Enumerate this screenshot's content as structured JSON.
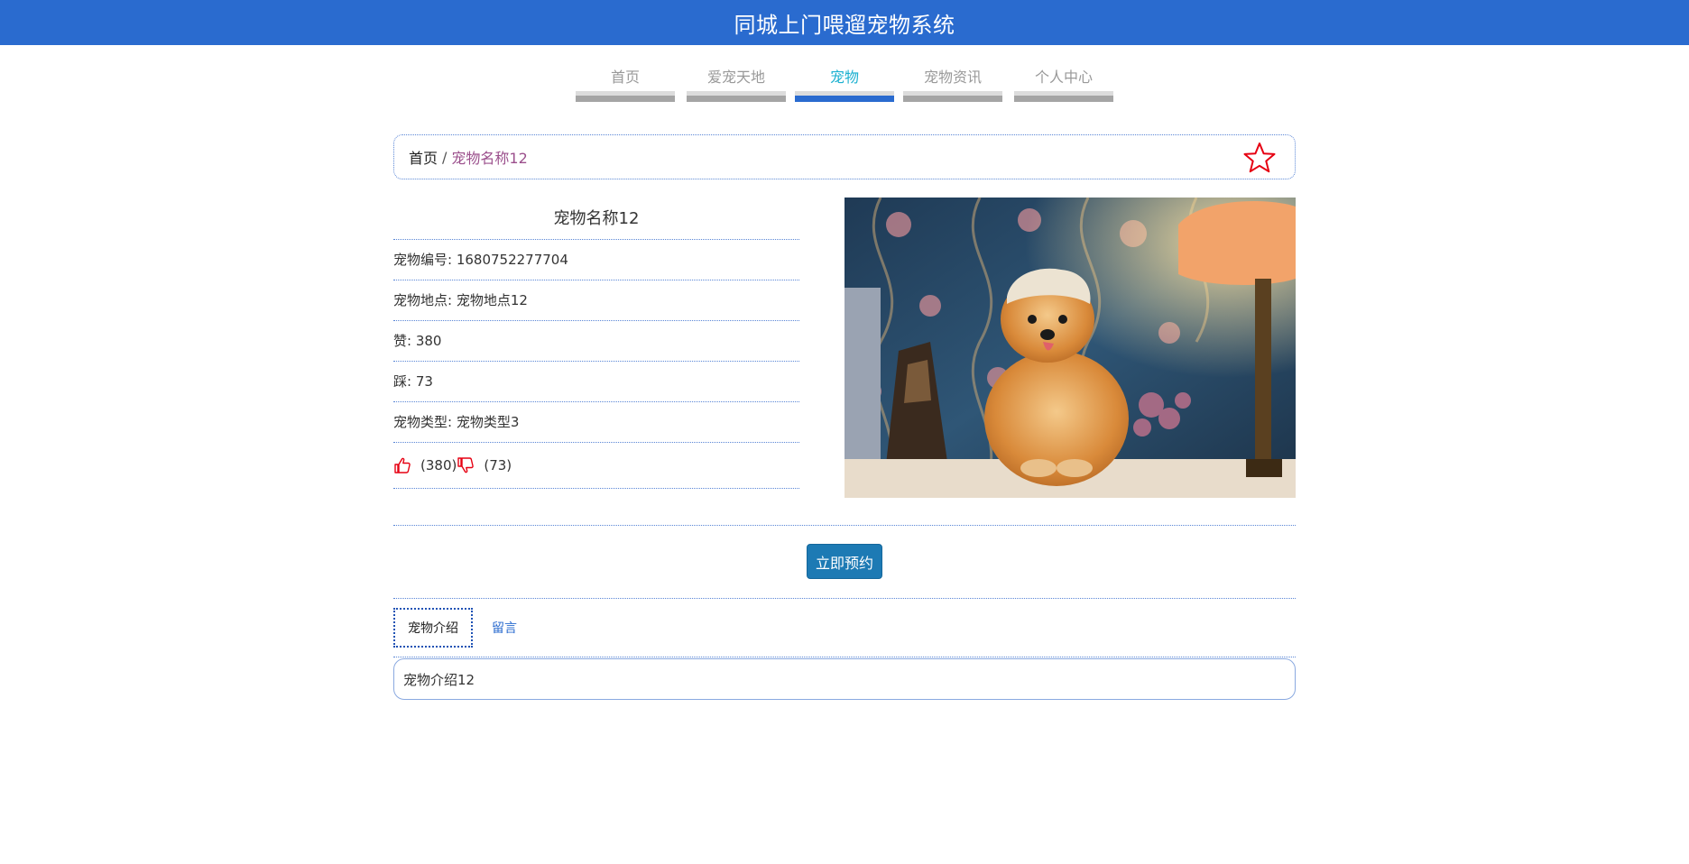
{
  "header": {
    "title": "同城上门喂遛宠物系统"
  },
  "nav": {
    "items": [
      {
        "label": "首页",
        "active": false
      },
      {
        "label": "爱宠天地",
        "active": false
      },
      {
        "label": "宠物",
        "active": true
      },
      {
        "label": "宠物资讯",
        "active": false
      },
      {
        "label": "个人中心",
        "active": false
      }
    ]
  },
  "breadcrumb": {
    "home": "首页",
    "separator": "/",
    "current": "宠物名称12"
  },
  "pet": {
    "name": "宠物名称12",
    "rows": [
      {
        "label": "宠物编号: 1680752277704"
      },
      {
        "label": "宠物地点: 宠物地点12"
      },
      {
        "label": "赞: 380"
      },
      {
        "label": "踩: 73"
      },
      {
        "label": "宠物类型: 宠物类型3"
      }
    ],
    "like_count": "(380)",
    "dislike_count": "(73)"
  },
  "actions": {
    "reserve_label": "立即预约"
  },
  "tabs": {
    "intro": "宠物介绍",
    "message": "留言"
  },
  "intro_text": "宠物介绍12",
  "colors": {
    "header_bg": "#2a6bcf",
    "active_nav": "#1ab0d0",
    "button_bg": "#1d7ab4",
    "accent_red": "#e60012"
  },
  "icons": {
    "favorite": "star-outline-icon",
    "like": "thumbs-up-icon",
    "dislike": "thumbs-down-icon"
  }
}
